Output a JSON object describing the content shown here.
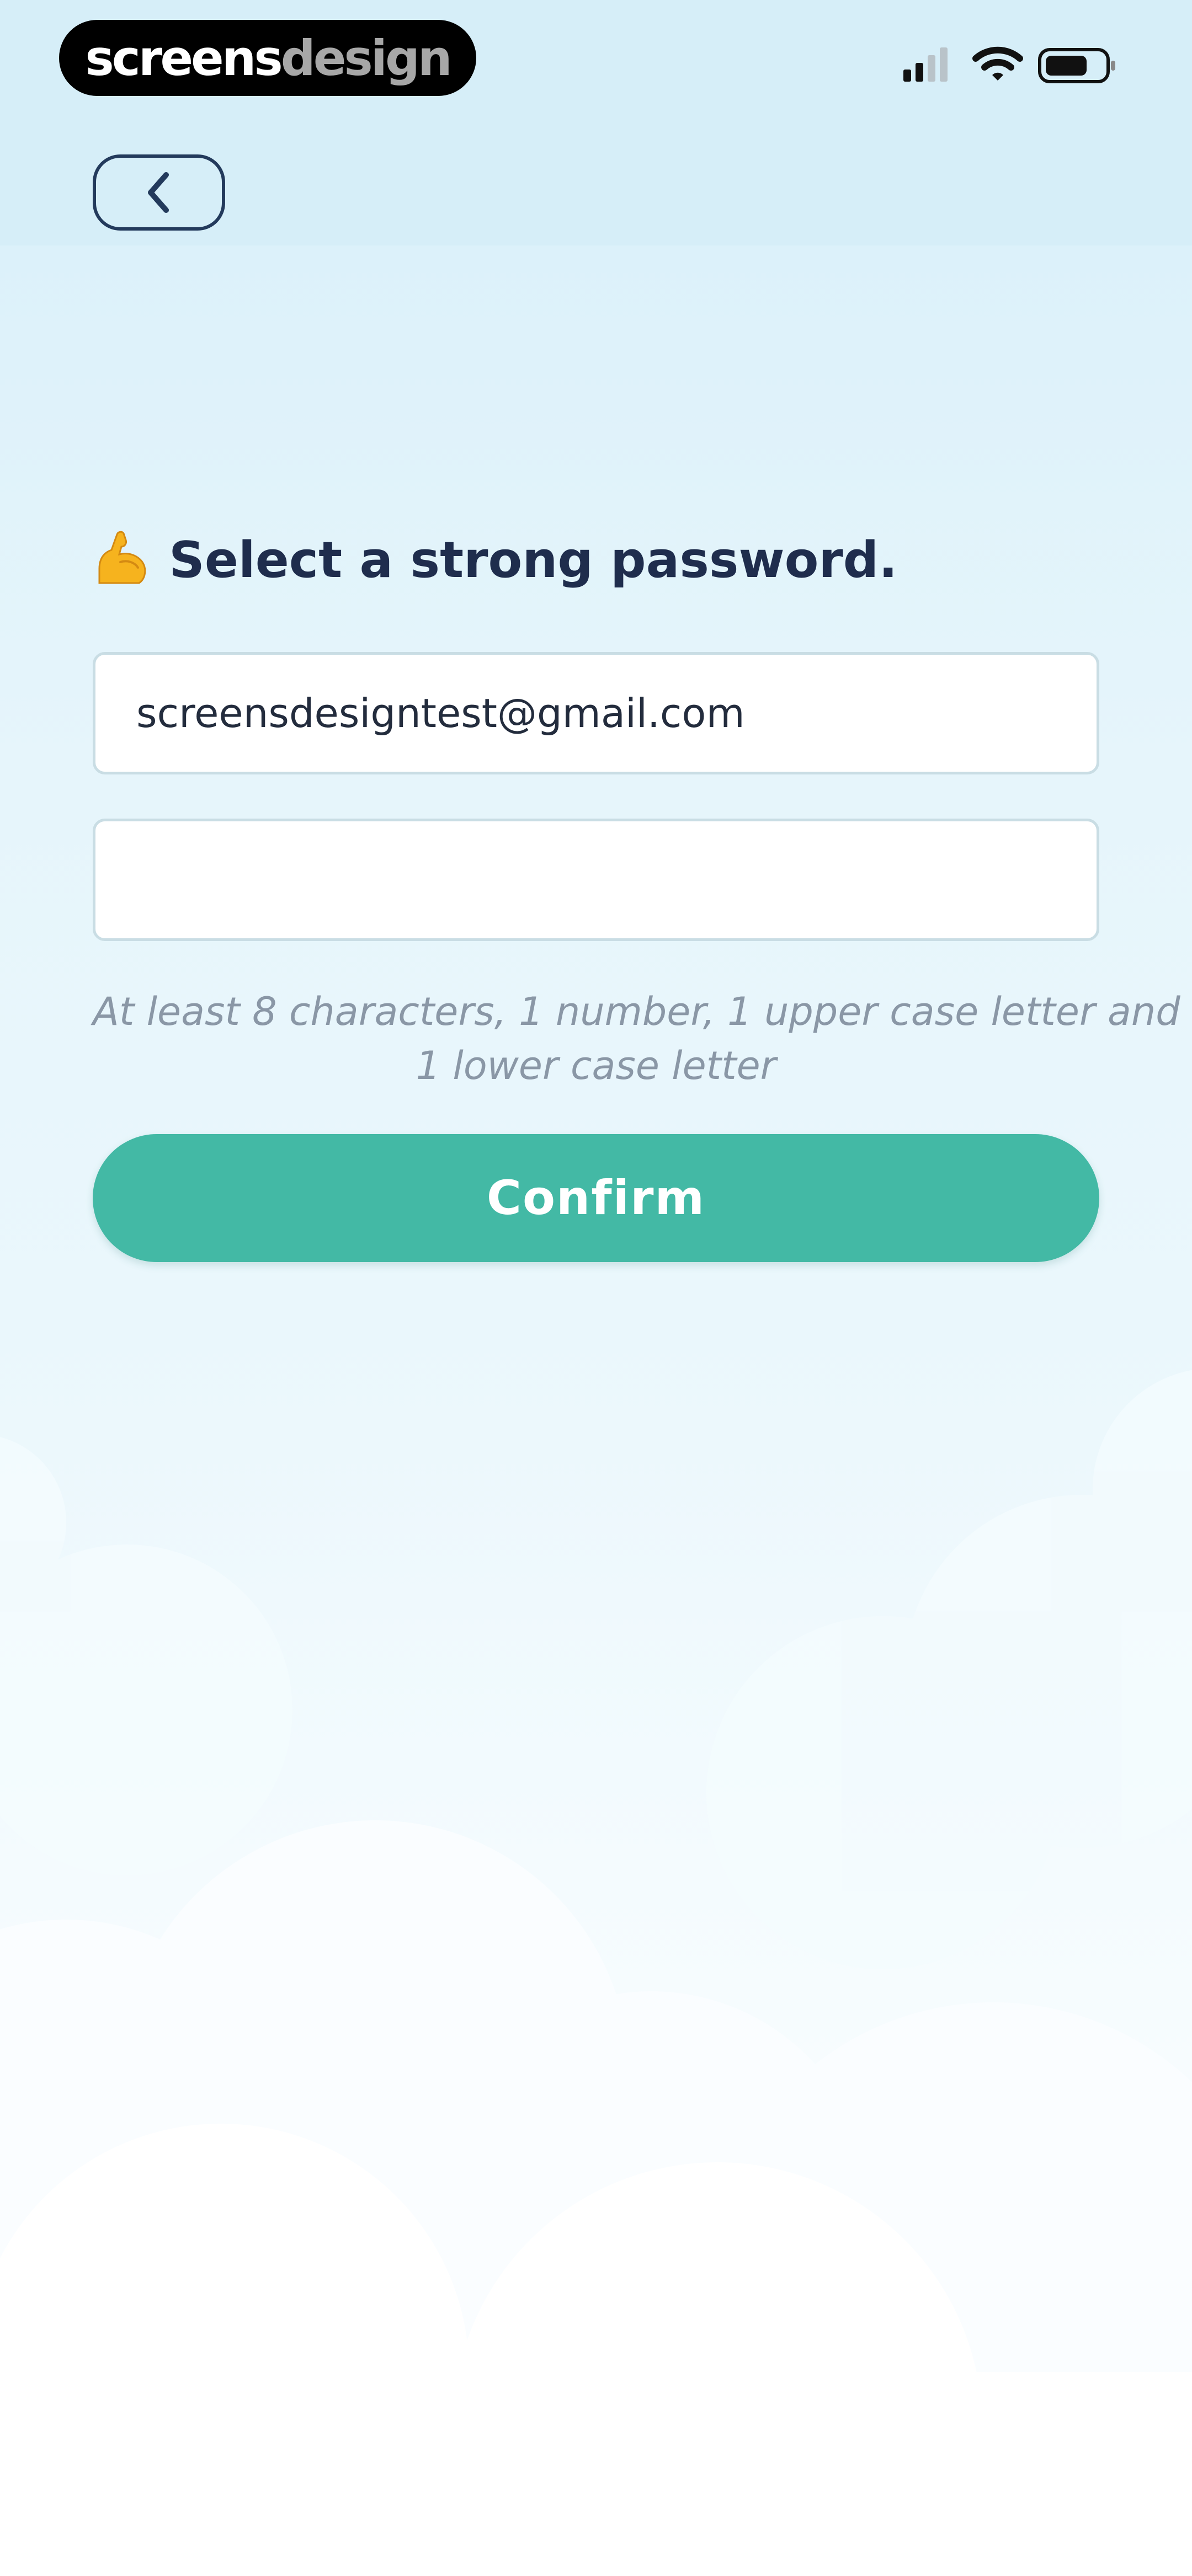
{
  "status_bar": {
    "brand_part_1": "screens",
    "brand_part_2": "design",
    "signal_icon": "cellular-signal-icon",
    "wifi_icon": "wifi-icon",
    "battery_icon": "battery-icon"
  },
  "nav": {
    "back_icon": "chevron-left-icon"
  },
  "heading": {
    "emoji": "flexed-biceps-emoji",
    "text": "Select a strong password."
  },
  "form": {
    "email_value": "screensdesigntest@gmail.com",
    "password_value": "",
    "hint_line_1": "At least 8 characters, 1 number, 1 upper case letter and",
    "hint_line_2": "1 lower case letter",
    "confirm_label": "Confirm"
  },
  "colors": {
    "accent": "#43b9a5",
    "heading": "#1f2d4d",
    "hint": "#8a97a6",
    "background_top": "#d6eef8"
  }
}
